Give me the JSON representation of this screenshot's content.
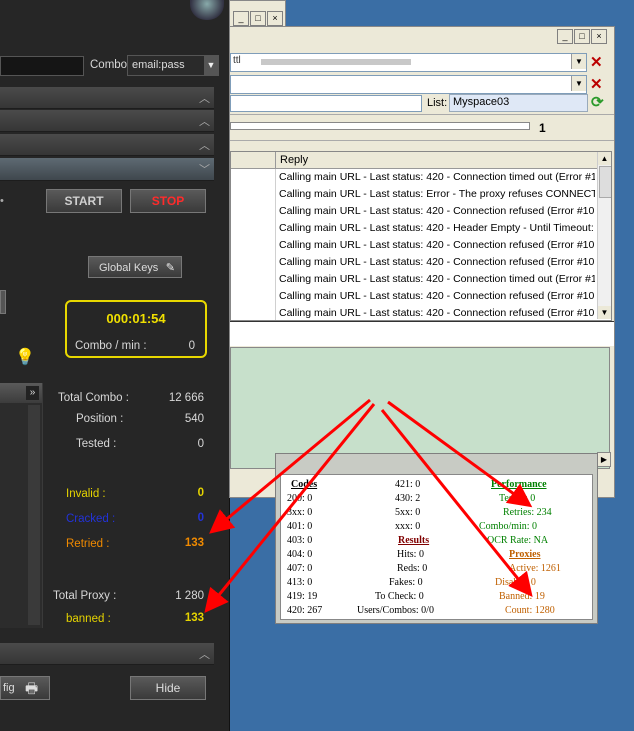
{
  "top_window": {
    "min": "_",
    "max": "□",
    "close": "×"
  },
  "dark": {
    "combo_label": "Combo",
    "combo_value": "email:pass",
    "start": "START",
    "stop": "STOP",
    "global_keys": "Global Keys",
    "timer": "000:01:54",
    "combo_min_label": "Combo / min :",
    "combo_min_value": "0",
    "total_combo_label": "Total Combo :",
    "total_combo_value": "12 666",
    "position_label": "Position :",
    "position_value": "540",
    "tested_label": "Tested :",
    "tested_value": "0",
    "invalid_label": "Invalid :",
    "invalid_value": "0",
    "cracked_label": "Cracked :",
    "cracked_value": "0",
    "retried_label": "Retried :",
    "retried_value": "133",
    "total_proxy_label": "Total Proxy :",
    "total_proxy_value": "1 280",
    "banned_label": "banned :",
    "banned_value": "133",
    "config_label": "fig",
    "hide": "Hide",
    "colors": {
      "invalid": "#e6d400",
      "cracked": "#2333d8",
      "retried": "#f08a00",
      "banned": "#e6d400",
      "timer": "#f0e000",
      "stop": "#ff2b2b"
    }
  },
  "win": {
    "url_text": "ttl",
    "list_label": "List:",
    "list_value": "Myspace03",
    "progress_value": "1",
    "reply_header": "Reply",
    "rows": [
      "Calling main URL - Last status: 420 - Connection timed out (Error #1...",
      "Calling main URL - Last status: Error - The proxy refuses CONNECT...",
      "Calling main URL - Last status: 420 - Connection refused (Error #10...",
      "Calling main URL - Last status: 420 - Header Empty - Until Timeout: ...",
      "Calling main URL - Last status: 420 - Connection refused (Error #10...",
      "Calling main URL - Last status: 420 - Connection refused (Error #10...",
      "Calling main URL - Last status: 420 - Connection timed out (Error #1...",
      "Calling main URL - Last status: 420 - Connection refused (Error #10...",
      "Calling main URL - Last status: 420 - Connection refused (Error #10..."
    ]
  },
  "stats": {
    "codes_header": "Codes",
    "codes": [
      "200: 0",
      "3xx: 0",
      "401: 0",
      "403: 0",
      "404: 0",
      "407: 0",
      "413: 0",
      "419: 19",
      "420: 267"
    ],
    "mid_top": [
      "421: 0",
      "430: 2",
      "5xx: 0",
      "xxx: 0"
    ],
    "results_header": "Results",
    "results": [
      "Hits: 0",
      "Reds: 0",
      "Fakes: 0",
      "To Check: 0",
      "Users/Combos: 0/0"
    ],
    "performance_header": "Performance",
    "performance": [
      "Tested: 0",
      "Retries: 234",
      "Combo/min: 0",
      "OCR Rate: NA"
    ],
    "proxies_header": "Proxies",
    "proxies": [
      "Active: 1261",
      "Disable: 0",
      "Banned: 19",
      "Count: 1280"
    ],
    "colors": {
      "performance": "#008000",
      "proxies": "#c06000",
      "results": "#800000"
    }
  },
  "arrows": {
    "color": "#ff0000"
  }
}
